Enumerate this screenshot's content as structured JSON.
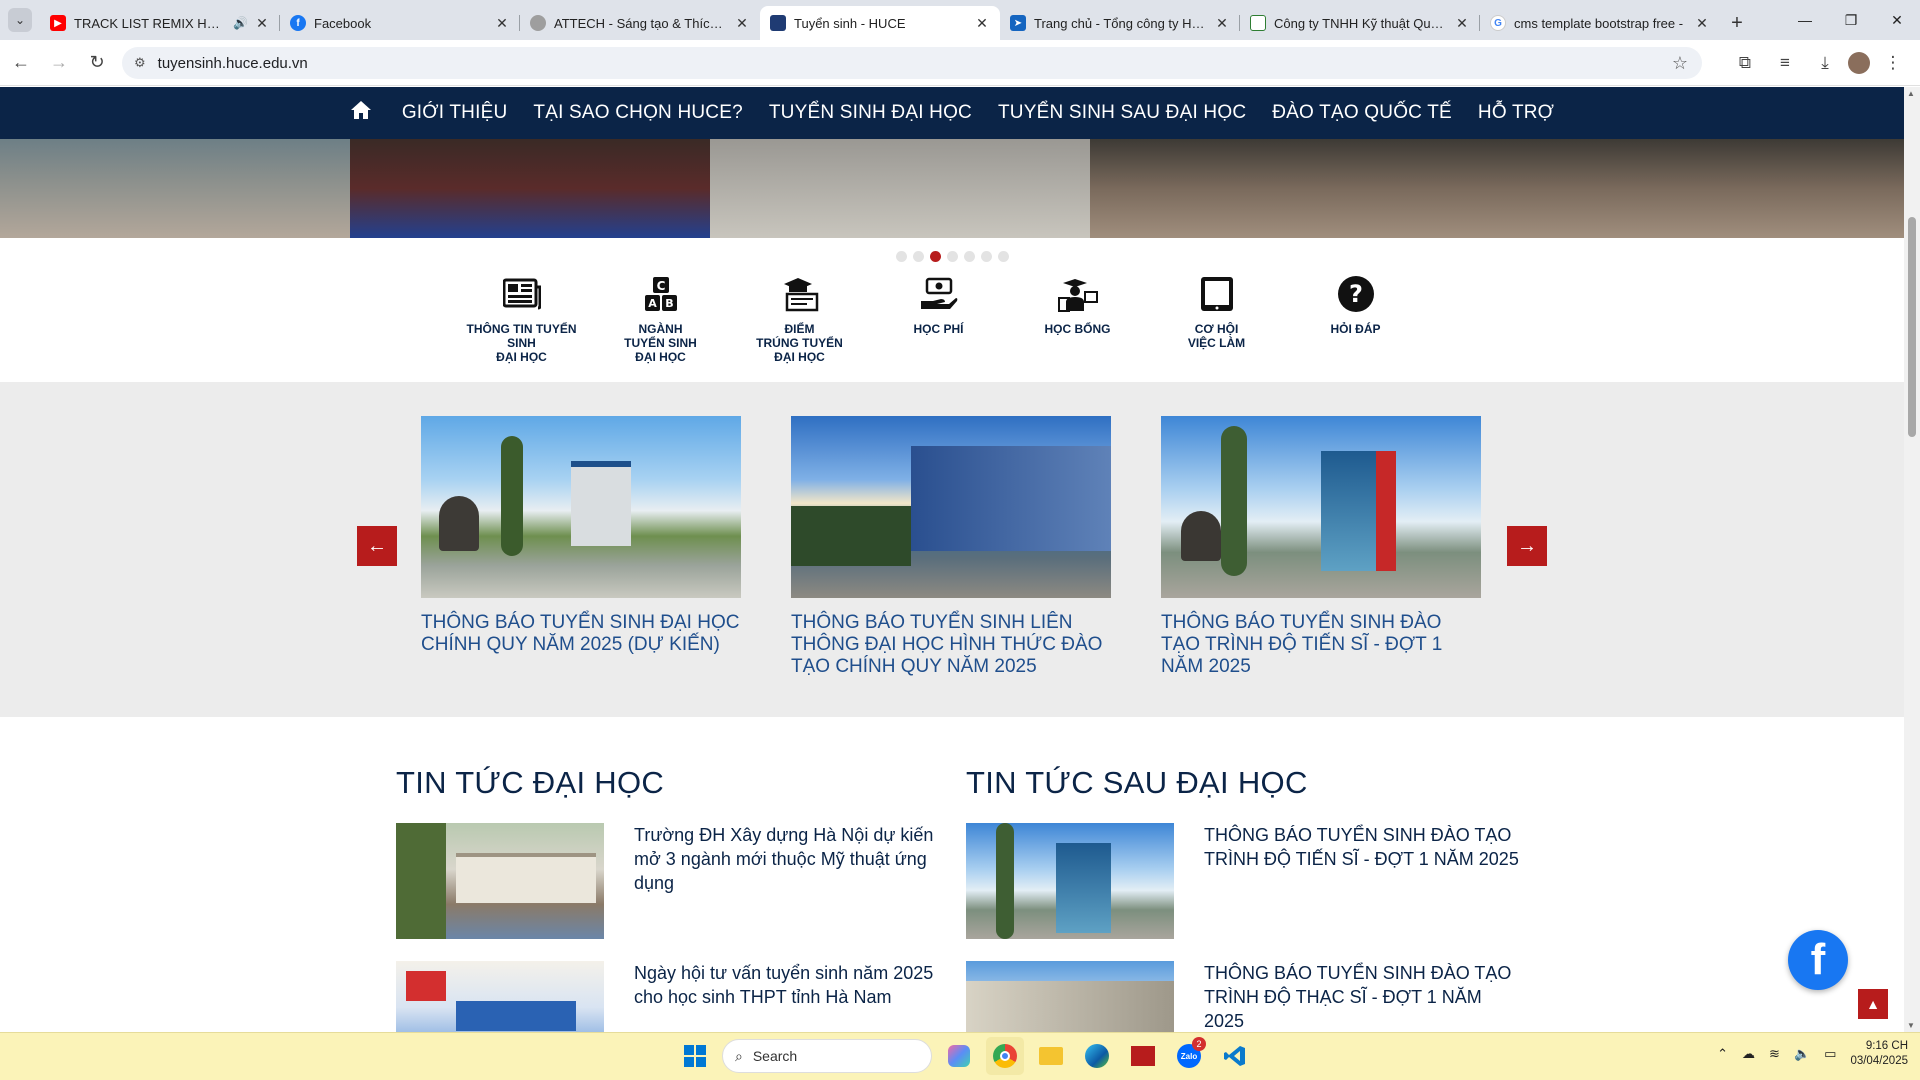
{
  "browser": {
    "tabs": [
      {
        "title": "TRACK LIST REMIX HOT TIK",
        "favicon": "youtube-icon",
        "color": "#ff0000",
        "audio": true
      },
      {
        "title": "Facebook",
        "favicon": "facebook-icon",
        "color": "#1877f2"
      },
      {
        "title": "ATTECH - Sáng tạo & Thích ngh",
        "favicon": "globe-icon",
        "color": "#888888"
      },
      {
        "title": "Tuyển sinh - HUCE",
        "favicon": "huce-icon",
        "color": "#1f3b73",
        "active": true
      },
      {
        "title": "Trang chủ - Tổng công ty Hàng",
        "favicon": "plane-icon",
        "color": "#1565c0"
      },
      {
        "title": "Công ty TNHH Kỹ thuật Quản lý",
        "favicon": "company-icon",
        "color": "#2e7d32"
      },
      {
        "title": "cms template bootstrap free -",
        "favicon": "google-icon",
        "color": "#4285f4"
      }
    ],
    "url": "tuyensinh.huce.edu.vn"
  },
  "nav": {
    "items": [
      "GIỚI THIỆU",
      "TẠI SAO CHỌN HUCE?",
      "TUYỂN SINH ĐẠI HỌC",
      "TUYỂN SINH SAU ĐẠI HỌC",
      "ĐÀO TẠO QUỐC TẾ",
      "HỖ TRỢ"
    ]
  },
  "slider": {
    "dot_count": 7,
    "active_index": 2
  },
  "quick_links": [
    {
      "label": "THÔNG TIN TUYỂN SINH\nĐẠI HỌC",
      "icon": "newspaper-icon"
    },
    {
      "label": "NGÀNH\nTUYỂN SINH\nĐẠI HỌC",
      "icon": "abc-blocks-icon"
    },
    {
      "label": "ĐIỂM\nTRÚNG TUYỂN\nĐẠI HỌC",
      "icon": "graduation-board-icon"
    },
    {
      "label": "HỌC PHÍ",
      "icon": "money-hand-icon"
    },
    {
      "label": "HỌC BỔNG",
      "icon": "scholar-icon"
    },
    {
      "label": "CƠ HỘI\nVIỆC LÀM",
      "icon": "tablet-icon"
    },
    {
      "label": "HỎI ĐÁP",
      "icon": "question-icon"
    }
  ],
  "featured": [
    {
      "title": "THÔNG BÁO TUYỂN SINH ĐẠI HỌC CHÍNH QUY NĂM 2025 (DỰ KIẾN)"
    },
    {
      "title": "THÔNG BÁO TUYỂN SINH LIÊN THÔNG ĐẠI HỌC HÌNH THỨC ĐÀO TẠO CHÍNH QUY NĂM 2025"
    },
    {
      "title": "THÔNG BÁO TUYỂN SINH ĐÀO TẠO TRÌNH ĐỘ TIẾN SĨ - ĐỢT 1 NĂM 2025"
    }
  ],
  "news_undergrad": {
    "heading": "TIN TỨC ĐẠI HỌC",
    "items": [
      {
        "title": "Trường ĐH Xây dựng Hà Nội dự kiến mở 3 ngành mới thuộc Mỹ thuật ứng dụng"
      },
      {
        "title": "Ngày hội tư vấn tuyển sinh năm 2025 cho học sinh THPT tỉnh Hà Nam"
      }
    ]
  },
  "news_postgrad": {
    "heading": "TIN TỨC SAU ĐẠI HỌC",
    "items": [
      {
        "title": "THÔNG BÁO TUYỂN SINH ĐÀO TẠO TRÌNH ĐỘ TIẾN SĨ - ĐỢT 1 NĂM 2025"
      },
      {
        "title": "THÔNG BÁO TUYỂN SINH ĐÀO TẠO TRÌNH ĐỘ THẠC SĨ - ĐỢT 1 NĂM 2025"
      }
    ]
  },
  "taskbar": {
    "search_placeholder": "Search",
    "zalo_badge": "2",
    "time": "9:16 CH",
    "date": "03/04/2025"
  },
  "colors": {
    "navy": "#0b2447",
    "accent_red": "#b71c1c",
    "link_blue": "#1f4e8c"
  }
}
